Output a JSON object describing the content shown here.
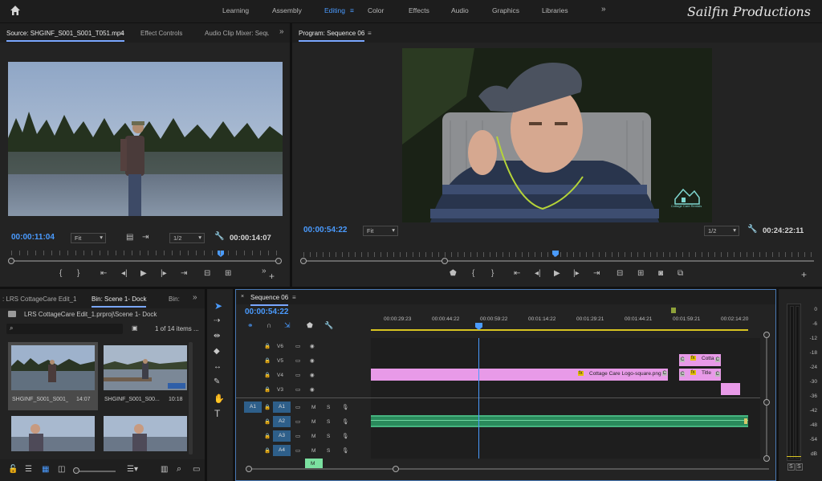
{
  "workspace": {
    "home": "home-icon",
    "tabs": [
      "Learning",
      "Assembly",
      "Editing",
      "Color",
      "Effects",
      "Audio",
      "Graphics",
      "Libraries"
    ],
    "active": "Editing",
    "more": "»",
    "brand": "Sailfin Productions"
  },
  "source": {
    "tabs": [
      "Source: SHGINF_S001_S001_T051.mp4",
      "Effect Controls",
      "Audio Clip Mixer: Sequ"
    ],
    "menu": "≡",
    "more": "»",
    "timecode": "00:00:11:04",
    "fit": "Fit",
    "resolution": "1/2",
    "duration": "00:00:14:07"
  },
  "program": {
    "title": "Program: Sequence 06",
    "menu": "≡",
    "timecode": "00:00:54:22",
    "fit": "Fit",
    "resolution": "1/2",
    "duration": "00:24:22:11",
    "logo_text": "Cottage Care Rentals"
  },
  "project": {
    "tabs": [
      ": LRS CottageCare Edit_1",
      "Bin: Scene 1- Dock",
      "Bin:"
    ],
    "more": "»",
    "path": "LRS CottageCare Edit_1.prproj\\Scene 1- Dock",
    "count": "1 of 14 items ...",
    "items": [
      {
        "name": "SHGINF_S001_S001_...",
        "duration": "14:07"
      },
      {
        "name": "SHGINF_S001_S00...",
        "duration": "10:18"
      }
    ]
  },
  "timeline": {
    "title": "Sequence 06",
    "menu": "≡",
    "timecode": "00:00:54:22",
    "ticks": [
      "00:00:29:23",
      "00:00:44:22",
      "00:00:59:22",
      "00:01:14:22",
      "00:01:29:21",
      "00:01:44:21",
      "00:01:59:21",
      "00:02:14:20"
    ],
    "video_tracks": [
      "V6",
      "V5",
      "V4",
      "V3"
    ],
    "audio_tracks": [
      "A1",
      "A2",
      "A3",
      "A4"
    ],
    "source_patch": "A1",
    "m": "M",
    "s": "S",
    "clips": {
      "logo": "Cottage Care Logo-square.png",
      "cotta": "Cotta",
      "title": "Title",
      "fx": "fx",
      "c": "C"
    }
  },
  "meter": {
    "labels": [
      "0",
      "-6",
      "-12",
      "-18",
      "-24",
      "-30",
      "-36",
      "-42",
      "-48",
      "-54",
      "dB"
    ],
    "solo": [
      "S",
      "S"
    ]
  },
  "colors": {
    "accent": "#4a9bff",
    "graphic_clip": "#e89ae8",
    "audio_clip": "#2a8a5c",
    "playhead": "#4a9bff"
  }
}
